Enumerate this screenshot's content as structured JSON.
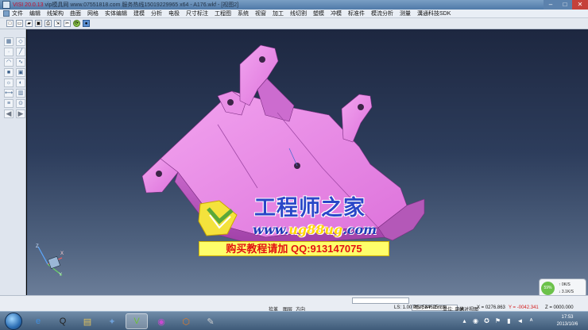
{
  "window": {
    "title_prefix": "VISI 20.0.13",
    "title_rest": " vip模具网 www.07551818.com 服务热线15019229965 x64 - A176.wkf - [视图2]",
    "minimize": "–",
    "maximize": "□",
    "close": "✕"
  },
  "menu": {
    "items": [
      "文件",
      "编辑",
      "线架构",
      "曲面",
      "网格",
      "实体编辑",
      "建模",
      "分析",
      "电极",
      "尺寸标注",
      "工程图",
      "系统",
      "视窗",
      "加工",
      "线切割",
      "塑模",
      "冲模",
      "标准件",
      "模流分析",
      "测量",
      "溝通科技SDK"
    ]
  },
  "toolbar": {
    "icons": [
      "new-file-icon",
      "open-file-icon",
      "folder-icon",
      "save-icon",
      "print-icon",
      "export-icon",
      "cut-icon",
      "refresh-icon",
      "render-icon"
    ]
  },
  "palette": {
    "icons": [
      "wireframe-icon",
      "surface-icon",
      "point-icon",
      "line-icon",
      "arc-icon",
      "curve-icon",
      "cube-icon",
      "solid-icon",
      "light-icon",
      "material-icon",
      "measure-icon",
      "section-icon",
      "layer-icon",
      "view-icon"
    ],
    "glyphs": [
      "▦",
      "◇",
      "·",
      "╱",
      "◠",
      "∿",
      "■",
      "▣",
      "☼",
      "◐",
      "⟷",
      "▥",
      "≡",
      "⊙"
    ],
    "arrows": [
      "◀",
      "▶"
    ]
  },
  "watermark": {
    "title": "工程师之家",
    "url_prefix": "www.",
    "url_highlight": "ug88ug",
    "url_suffix": ".com",
    "contact": "购买教程请加 QQ:913147075"
  },
  "axis": {
    "x": "X",
    "y": "Y",
    "z": "Z"
  },
  "network": {
    "percent": "59%",
    "up": "0K/S",
    "down": "3.1K/S"
  },
  "status": {
    "mode": "捡革",
    "layer_label": "图层",
    "layer_select": "",
    "dir_label": "方向",
    "view_select": "绝对 XY 上视图",
    "ls": "LS: 1.00 PS: 584605",
    "unit": "单位: 毫米",
    "view_label": "绝对视图",
    "x_coord": "X = 0276.863",
    "y_coord": "Y = -0042.341",
    "z_coord": "Z = 0000.000"
  },
  "taskbar": {
    "apps": [
      "ie-icon",
      "qq-icon",
      "explorer-icon",
      "app-icon",
      "visi-icon",
      "vnc-icon",
      "360-icon",
      "tool-icon"
    ],
    "glyphs": [
      "e",
      "Q",
      "▤",
      "✦",
      "V",
      "◉",
      "⬡",
      "✎"
    ],
    "time": "17:53",
    "date": "2013/10/6"
  },
  "colors": {
    "part": "#e27be0",
    "part_dark": "#b24fb5",
    "part_light": "#f3a8f0"
  }
}
